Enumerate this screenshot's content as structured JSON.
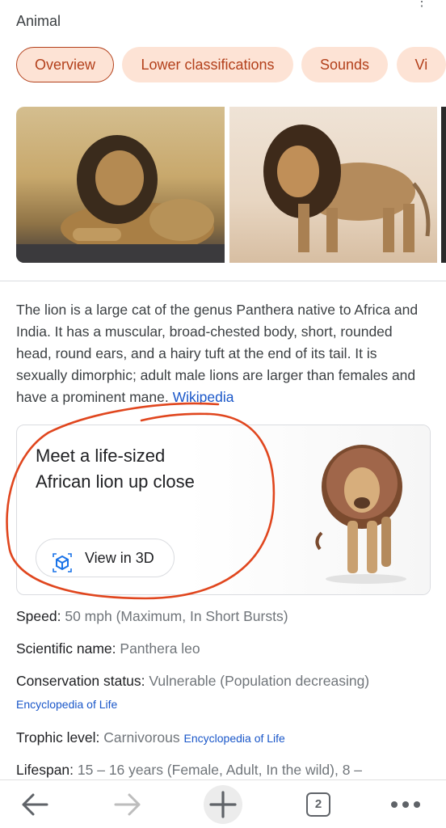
{
  "header": {
    "subtitle": "Animal"
  },
  "tabs": [
    {
      "label": "Overview"
    },
    {
      "label": "Lower classifications"
    },
    {
      "label": "Sounds"
    },
    {
      "label": "Vi"
    }
  ],
  "description": {
    "text": "The lion is a large cat of the genus Panthera native to Africa and India. It has a muscular, broad-chested body, short, rounded head, round ears, and a hairy tuft at the end of its tail. It is sexually dimorphic; adult male lions are larger than females and have a prominent mane.",
    "source": "Wikipedia"
  },
  "card3d": {
    "title": "Meet a life-sized African lion up close",
    "button": "View in 3D"
  },
  "facts": {
    "speed_label": "Speed:",
    "speed_value": "50 mph (Maximum, In Short Bursts)",
    "sci_label": "Scientific name:",
    "sci_value": "Panthera leo",
    "cons_label": "Conservation status:",
    "cons_value": "Vulnerable (Population decreasing)",
    "cons_source": "Encyclopedia of Life",
    "trophic_label": "Trophic level:",
    "trophic_value": "Carnivorous",
    "trophic_source": "Encyclopedia of Life",
    "lifespan_label": "Lifespan:",
    "lifespan_value": "15 – 16 years (Female, Adult, In the wild), 8 –"
  },
  "bottom_nav": {
    "tab_count": "2",
    "icons": [
      "back-arrow-icon",
      "forward-arrow-icon",
      "plus-icon",
      "tab-switcher-icon",
      "more-icon"
    ]
  },
  "colors": {
    "tab_bg": "#fde3d5",
    "tab_text": "#b3401b",
    "link": "#1a57c9",
    "annotation": "#e0461e"
  }
}
